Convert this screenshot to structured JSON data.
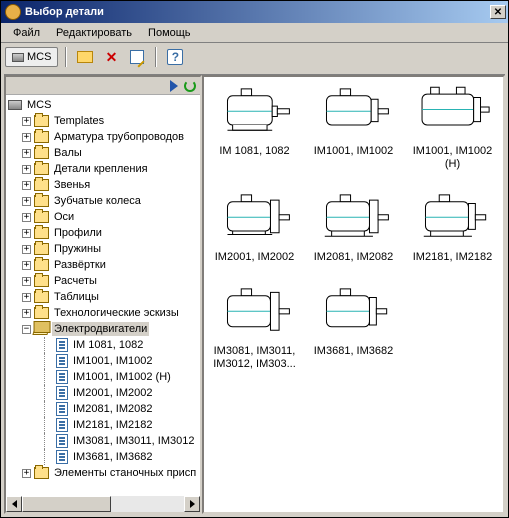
{
  "window": {
    "title": "Выбор детали"
  },
  "menu": {
    "file": "Файл",
    "edit": "Редактировать",
    "help": "Помощь"
  },
  "toolbar": {
    "mcs": "MCS"
  },
  "tree": {
    "root": "MCS",
    "folders": [
      "Templates",
      "Арматура трубопроводов",
      "Валы",
      "Детали крепления",
      "Звенья",
      "Зубчатые колеса",
      "Оси",
      "Профили",
      "Пружины",
      "Развёртки",
      "Расчеты",
      "Таблицы",
      "Технологические эскизы"
    ],
    "selected_folder": "Электродвигатели",
    "items": [
      "IM 1081, 1082",
      "IM1001, IM1002",
      "IM1001, IM1002 (H)",
      "IM2001, IM2002",
      "IM2081, IM2082",
      "IM2181, IM2182",
      "IM3081, IM3011, IM3012",
      "IM3681, IM3682"
    ],
    "last_folder": "Элементы станочных присп"
  },
  "content": {
    "row1": [
      "IM 1081, 1082",
      "IM1001, IM1002",
      "IM1001, IM1002 (H)"
    ],
    "row2": [
      "IM2001, IM2002",
      "IM2081, IM2082",
      "IM2181, IM2182"
    ],
    "row3": [
      "IM3081, IM3011, IM3012, IM303...",
      "IM3681, IM3682"
    ]
  }
}
